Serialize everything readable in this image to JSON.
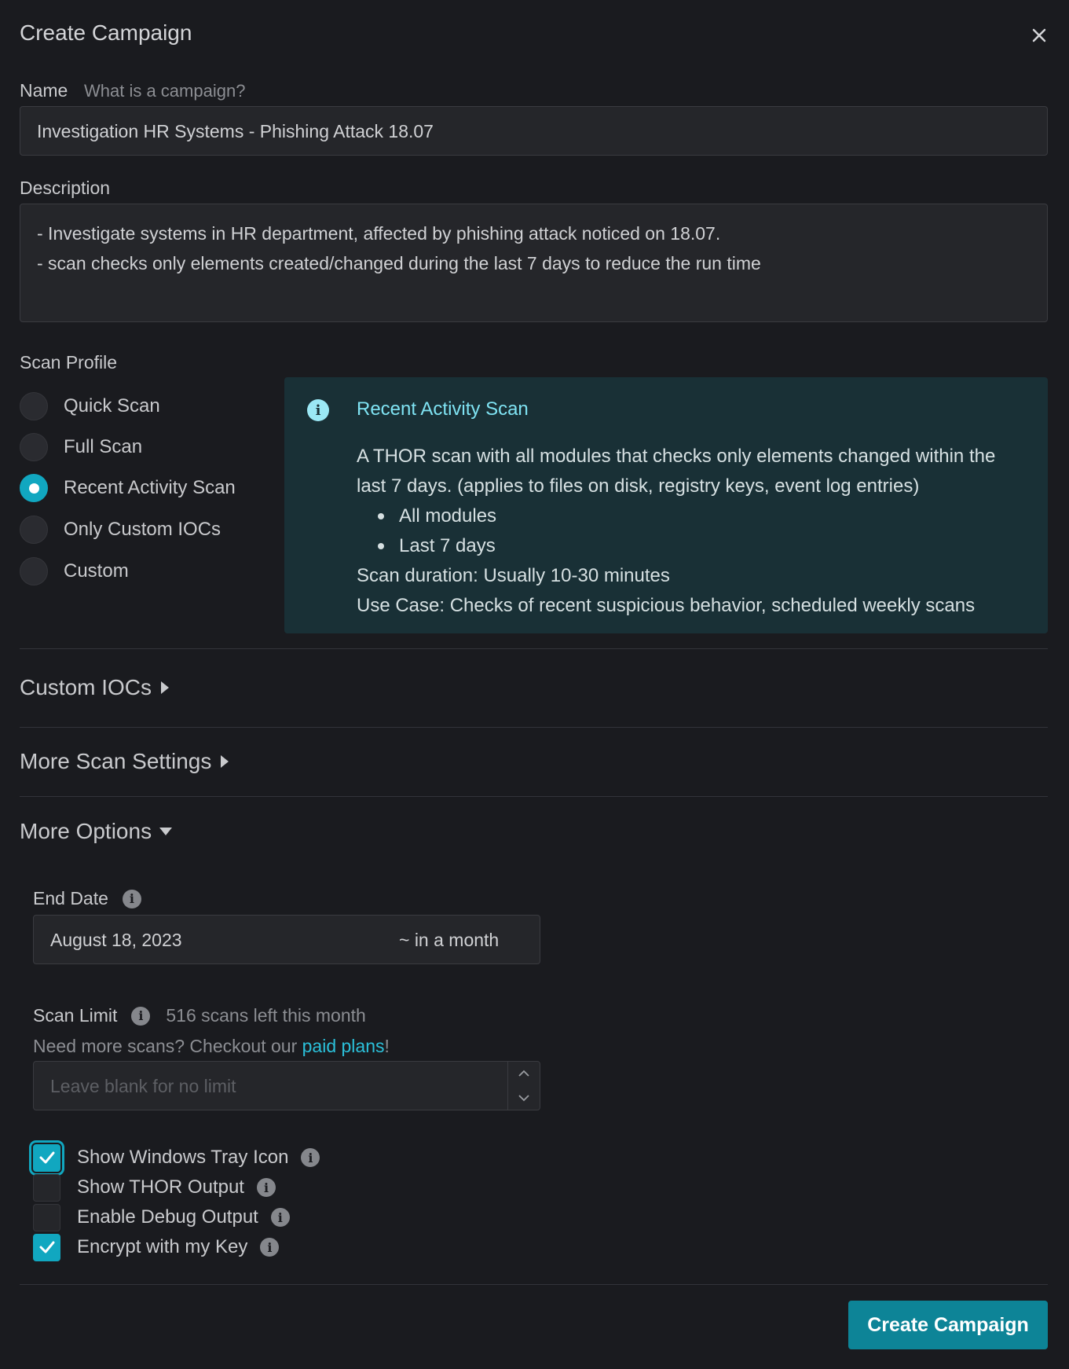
{
  "dialog": {
    "title": "Create Campaign",
    "close_icon": "close-icon"
  },
  "name": {
    "label": "Name",
    "help_link": "What is a campaign?",
    "value": "Investigation HR Systems - Phishing Attack 18.07"
  },
  "description": {
    "label": "Description",
    "lines": [
      "- Investigate systems in HR department, affected by phishing attack noticed on 18.07.",
      "- scan checks only elements created/changed during the last 7 days to reduce the run time"
    ]
  },
  "scan_profile": {
    "label": "Scan Profile",
    "options": [
      {
        "label": "Quick Scan",
        "selected": false
      },
      {
        "label": "Full Scan",
        "selected": false
      },
      {
        "label": "Recent Activity Scan",
        "selected": true
      },
      {
        "label": "Only Custom IOCs",
        "selected": false
      },
      {
        "label": "Custom",
        "selected": false
      }
    ],
    "info": {
      "icon": "info-icon",
      "title": "Recent Activity Scan",
      "description_line1": "A THOR scan with all modules that checks only elements changed within the",
      "description_line2": "last 7 days. (applies to files on disk, registry keys, event log entries)",
      "bullets": [
        "All modules",
        "Last 7 days"
      ],
      "duration": "Scan duration: Usually 10-30 minutes",
      "use_case": "Use Case: Checks of recent suspicious behavior, scheduled weekly scans"
    }
  },
  "sections": {
    "custom_iocs": "Custom IOCs",
    "more_scan_settings": "More Scan Settings",
    "more_options": "More Options"
  },
  "end_date": {
    "label": "End Date",
    "value": "August 18, 2023",
    "relative": "~ in a month"
  },
  "scan_limit": {
    "label": "Scan Limit",
    "remaining": "516 scans left this month",
    "upsell_prefix": "Need more scans? Checkout our ",
    "upsell_link": "paid plans",
    "upsell_suffix": "!",
    "placeholder": "Leave blank for no limit"
  },
  "checkboxes": [
    {
      "label": "Show Windows Tray Icon",
      "checked": true
    },
    {
      "label": "Show THOR Output",
      "checked": false
    },
    {
      "label": "Enable Debug Output",
      "checked": false
    },
    {
      "label": "Encrypt with my Key",
      "checked": true
    }
  ],
  "footer": {
    "submit_label": "Create Campaign"
  },
  "colors": {
    "background": "#1a1b1f",
    "accent": "#11a7c0",
    "info_panel": "#193036",
    "info_title": "#7fe3f3",
    "link": "#2bc0da",
    "button": "#0d8497"
  }
}
